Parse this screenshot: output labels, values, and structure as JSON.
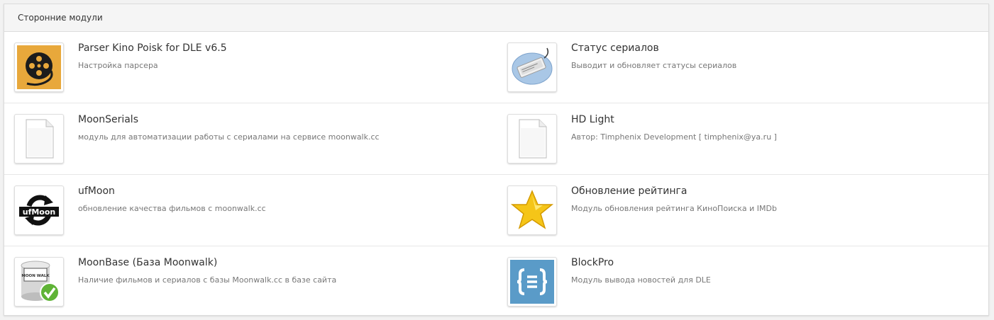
{
  "panel": {
    "title": "Сторонние модули"
  },
  "modules": [
    {
      "title": "Parser Kino Poisk for DLE v6.5",
      "description": "Настройка парсера",
      "icon": "film-reel-icon"
    },
    {
      "title": "Статус сериалов",
      "description": "Выводит и обновляет статусы сериалов",
      "icon": "keyboard-key-icon"
    },
    {
      "title": "MoonSerials",
      "description": "модуль для автоматизации работы с сериалами на сервисе moonwalk.cc",
      "icon": "blank-file-icon"
    },
    {
      "title": "HD Light",
      "description": "Автор: Timphenix Development [ timphenix@ya.ru ]",
      "icon": "blank-file-icon"
    },
    {
      "title": "ufMoon",
      "description": "обновление качества фильмов с moonwalk.cc",
      "icon": "ufmoon-sync-icon",
      "icon_text": "ufMoon"
    },
    {
      "title": "Обновление рейтинга",
      "description": "Модуль обновления рейтинга КиноПоиска и IMDb",
      "icon": "star-icon"
    },
    {
      "title": "MoonBase (База Moonwalk)",
      "description": "Наличие фильмов и сериалов с базы Moonwalk.cc в базе сайта",
      "icon": "database-check-icon",
      "icon_text": "MOON WALK"
    },
    {
      "title": "BlockPro",
      "description": "Модуль вывода новостей для DLE",
      "icon": "code-braces-icon"
    }
  ],
  "colors": {
    "film_bg": "#e8a83b",
    "blockpro_bg": "#5a9bc8",
    "star": "#f5c518",
    "check": "#5fb336"
  }
}
